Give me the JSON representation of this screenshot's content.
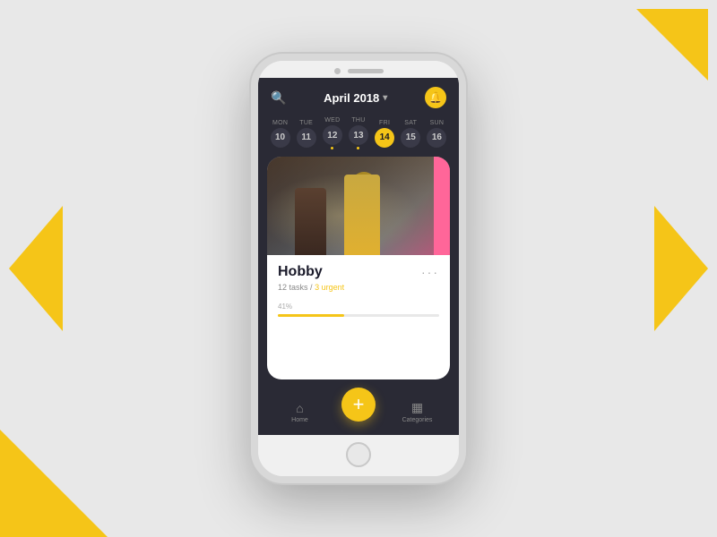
{
  "background": {
    "color": "#e8e8e8",
    "accent_color": "#F5C518"
  },
  "header": {
    "title": "April 2018",
    "chevron": "▾",
    "search_icon": "🔍",
    "notification_icon": "🔔"
  },
  "calendar": {
    "days": [
      {
        "name": "MON",
        "num": "10",
        "active": false,
        "dot": false
      },
      {
        "name": "TUE",
        "num": "11",
        "active": false,
        "dot": false
      },
      {
        "name": "WED",
        "num": "12",
        "active": false,
        "dot": true
      },
      {
        "name": "THU",
        "num": "13",
        "active": false,
        "dot": true
      },
      {
        "name": "FRI",
        "num": "14",
        "active": true,
        "dot": false
      },
      {
        "name": "SAT",
        "num": "15",
        "active": false,
        "dot": false
      },
      {
        "name": "SUN",
        "num": "16",
        "active": false,
        "dot": false
      }
    ]
  },
  "card": {
    "title": "Hobby",
    "subtitle_tasks": "12 tasks",
    "subtitle_separator": " / ",
    "subtitle_urgent": "3 urgent",
    "progress_percent": "41%",
    "progress_value": 41,
    "menu_dots": "···"
  },
  "bottom_nav": {
    "home_label": "Home",
    "categories_label": "Categories",
    "fab_icon": "+"
  }
}
